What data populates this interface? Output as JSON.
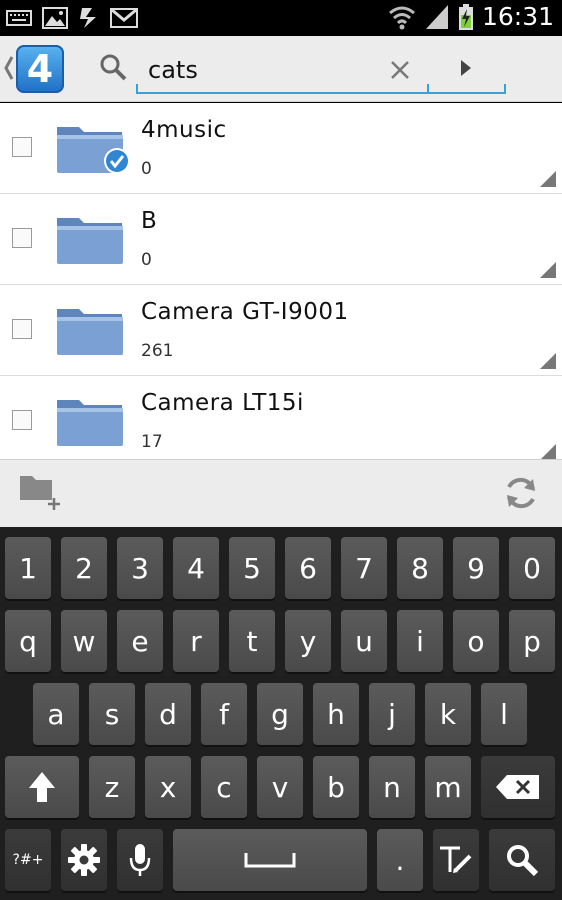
{
  "status_bar": {
    "time": "16:31",
    "icons": [
      "keyboard-icon",
      "image-icon",
      "usb-icon",
      "gmail-icon",
      "wifi-icon",
      "signal-icon",
      "battery-charging-icon"
    ]
  },
  "action_bar": {
    "logo_text": "4",
    "search": {
      "value": "cats"
    }
  },
  "list": {
    "items": [
      {
        "name": "4music",
        "count": "0",
        "checked_badge": true
      },
      {
        "name": "B",
        "count": "0",
        "checked_badge": false
      },
      {
        "name": "Camera GT-I9001",
        "count": "261",
        "checked_badge": false
      },
      {
        "name": "Camera LT15i",
        "count": "17",
        "checked_badge": false
      }
    ]
  },
  "toolbar": {
    "icons": [
      "new-folder-icon",
      "refresh-icon"
    ]
  },
  "keyboard": {
    "row1": [
      "1",
      "2",
      "3",
      "4",
      "5",
      "6",
      "7",
      "8",
      "9",
      "0"
    ],
    "row2": [
      "q",
      "w",
      "e",
      "r",
      "t",
      "y",
      "u",
      "i",
      "o",
      "p"
    ],
    "row3": [
      "a",
      "s",
      "d",
      "f",
      "g",
      "h",
      "j",
      "k",
      "l"
    ],
    "row4": [
      "z",
      "x",
      "c",
      "v",
      "b",
      "n",
      "m"
    ],
    "symbols_label": "?#+",
    "period_label": "."
  },
  "colors": {
    "accent": "#3aa0d8",
    "folder": "#6f93c8",
    "key": "#4f4f4f"
  }
}
